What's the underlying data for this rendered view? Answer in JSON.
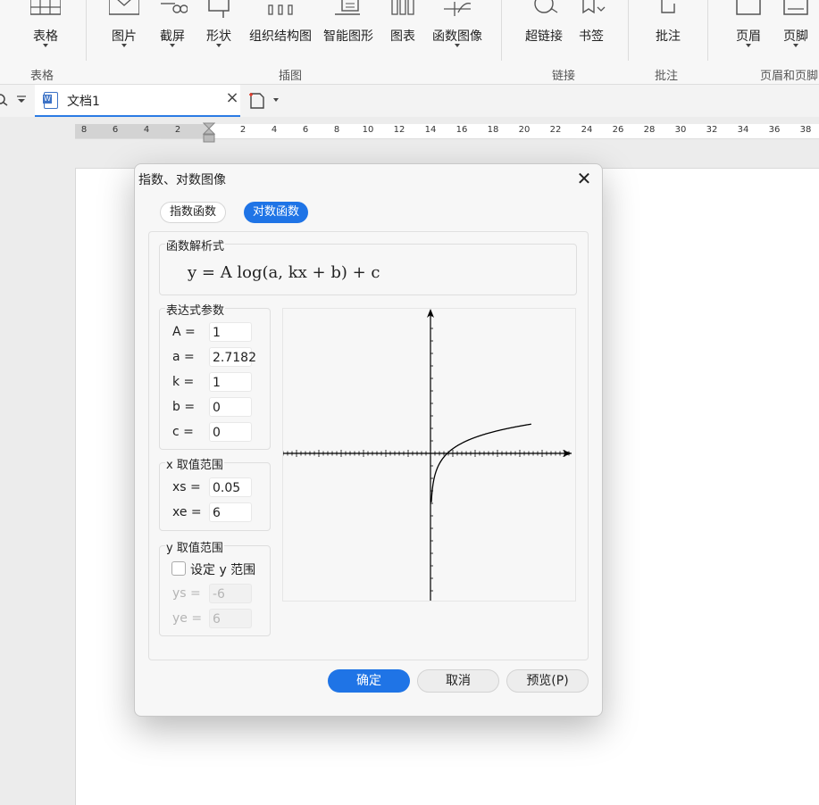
{
  "ribbon": {
    "buttons": [
      {
        "id": "table",
        "label": "表格",
        "icon": "table-icon"
      },
      {
        "id": "picture",
        "label": "图片",
        "icon": "picture-icon"
      },
      {
        "id": "screenshot",
        "label": "截屏",
        "icon": "scissors-icon"
      },
      {
        "id": "shape",
        "label": "形状",
        "icon": "shape-icon"
      },
      {
        "id": "orgchart",
        "label": "组织结构图",
        "icon": "org-chart-icon"
      },
      {
        "id": "smartart",
        "label": "智能图形",
        "icon": "smart-art-icon"
      },
      {
        "id": "chart",
        "label": "图表",
        "icon": "chart-icon"
      },
      {
        "id": "funcgraph",
        "label": "函数图像",
        "icon": "function-graph-icon"
      },
      {
        "id": "hyperlink",
        "label": "超链接",
        "icon": "hyperlink-icon"
      },
      {
        "id": "bookmark",
        "label": "书签",
        "icon": "bookmark-icon"
      },
      {
        "id": "comment",
        "label": "批注",
        "icon": "comment-icon"
      },
      {
        "id": "header",
        "label": "页眉",
        "icon": "header-icon"
      },
      {
        "id": "footer",
        "label": "页脚",
        "icon": "footer-icon"
      }
    ],
    "groups": {
      "table": "表格",
      "illustrations": "插图",
      "links": "链接",
      "comments": "批注",
      "header_footer": "页眉和页脚"
    }
  },
  "tab": {
    "name": "文档1"
  },
  "ruler": {
    "ticks": [
      "8",
      "6",
      "4",
      "2",
      "2",
      "4",
      "6",
      "8",
      "10",
      "12",
      "14",
      "16",
      "18",
      "20",
      "22",
      "24",
      "26",
      "28",
      "30",
      "32",
      "34",
      "36",
      "38"
    ]
  },
  "dialog": {
    "title": "指数、对数图像",
    "tabs": {
      "exponential": "指数函数",
      "logarithmic": "对数函数",
      "active": "logarithmic"
    },
    "formula_legend": "函数解析式",
    "formula": "y = A  log(a, kx + b) + c",
    "params_legend": "表达式参数",
    "params": [
      {
        "label": "A =",
        "value": "1"
      },
      {
        "label": "a =",
        "value": "2.7182"
      },
      {
        "label": "k =",
        "value": "1"
      },
      {
        "label": "b =",
        "value": "0"
      },
      {
        "label": "c =",
        "value": "0"
      }
    ],
    "x_range_legend": "x 取值范围",
    "x_range": [
      {
        "label": "xs =",
        "value": "0.05"
      },
      {
        "label": "xe =",
        "value": "6"
      }
    ],
    "y_range_legend": "y 取值范围",
    "y_range_checkbox": "设定 y 范围",
    "y_range_checked": false,
    "y_range": [
      {
        "label": "ys =",
        "value": "-6"
      },
      {
        "label": "ye =",
        "value": "6"
      }
    ],
    "buttons": {
      "ok": "确定",
      "cancel": "取消",
      "preview": "预览(P)"
    }
  }
}
